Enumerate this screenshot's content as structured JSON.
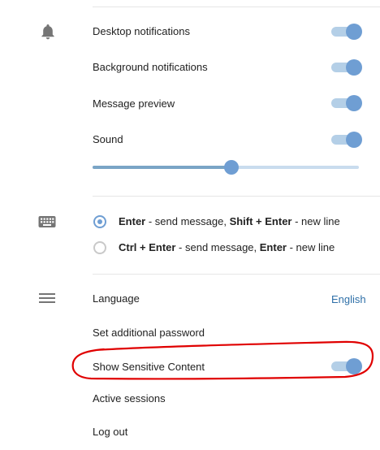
{
  "notifications": {
    "desktop": {
      "label": "Desktop notifications",
      "enabled": true
    },
    "background": {
      "label": "Background notifications",
      "enabled": true
    },
    "preview": {
      "label": "Message preview",
      "enabled": true
    },
    "sound": {
      "label": "Sound",
      "enabled": true,
      "volume_percent": 52
    }
  },
  "send_shortcut": {
    "options": [
      {
        "key1": "Enter",
        "mid": " - send message, ",
        "key2": "Shift + Enter",
        "end": " - new line",
        "selected": true
      },
      {
        "key1": "Ctrl + Enter",
        "mid": " - send message, ",
        "key2": "Enter",
        "end": " - new line",
        "selected": false
      }
    ]
  },
  "general": {
    "language_label": "Language",
    "language_value": "English",
    "additional_password": "Set additional password",
    "sensitive_content": {
      "label": "Show Sensitive Content",
      "enabled": true
    },
    "active_sessions": "Active sessions",
    "log_out": "Log out"
  },
  "icons": {
    "notifications": "bell-icon",
    "keyboard": "keyboard-icon",
    "general": "menu-icon"
  },
  "colors": {
    "accent": "#6f9ed3",
    "toggle_track": "#b4cfe7",
    "link": "#2f70a8",
    "annotation": "#e00000"
  }
}
